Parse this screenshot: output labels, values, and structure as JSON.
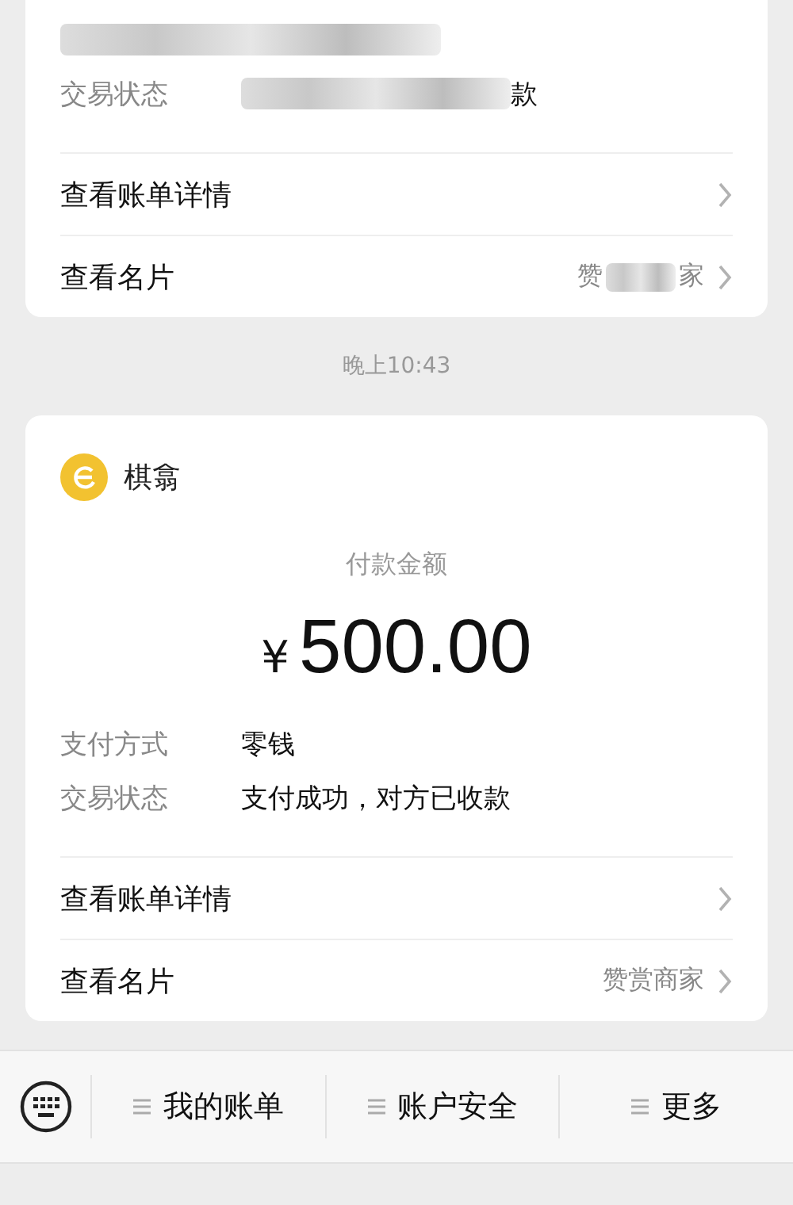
{
  "earlier_card": {
    "status_label": "交易状态",
    "status_value_tail": "款",
    "detail_link": "查看账单详情",
    "card_link": "查看名片",
    "card_value_head": "赞",
    "card_value_tail": "家"
  },
  "time": "晚上10:43",
  "payment_card": {
    "merchant": "棋翕",
    "amount_label": "付款金额",
    "currency": "¥",
    "amount": "500.00",
    "fields": [
      {
        "label": "支付方式",
        "value": "零钱"
      },
      {
        "label": "交易状态",
        "value": "支付成功，对方已收款"
      }
    ],
    "links": [
      {
        "label": "查看账单详情"
      },
      {
        "label": "查看名片",
        "value": "赞赏商家"
      }
    ]
  },
  "menu": [
    {
      "label": "我的账单"
    },
    {
      "label": "账户安全"
    },
    {
      "label": "更多"
    }
  ]
}
